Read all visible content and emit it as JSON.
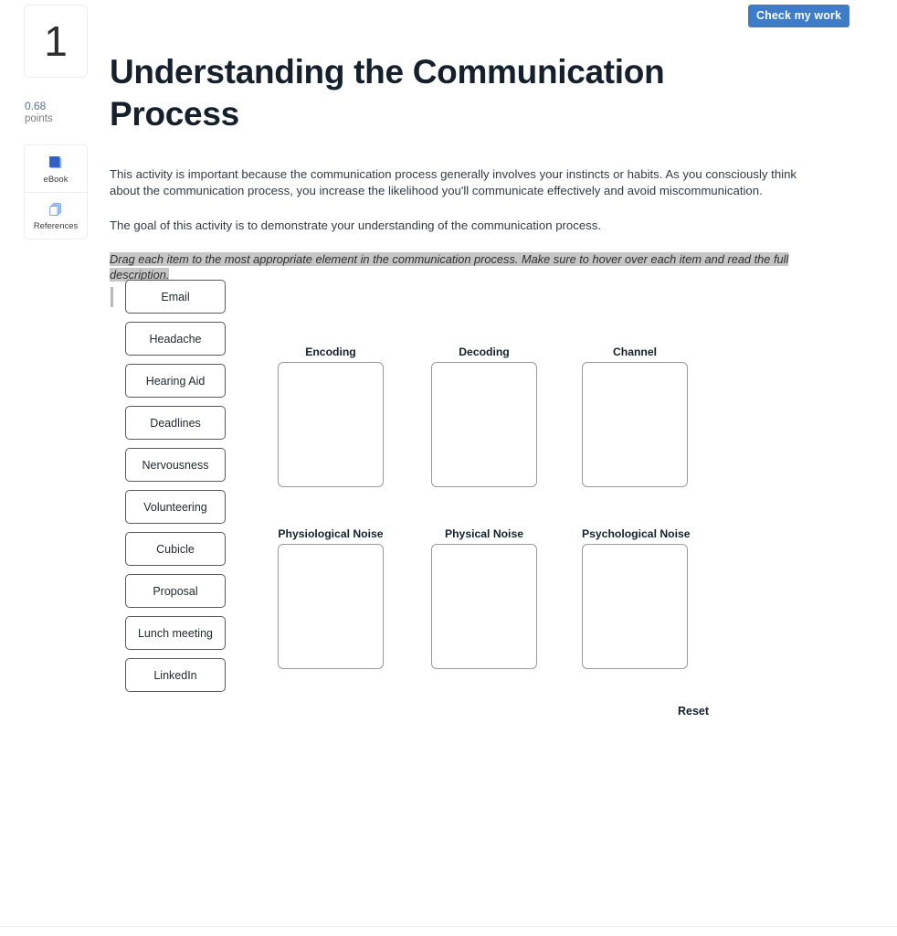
{
  "toolbar": {
    "check_work_label": "Check my work"
  },
  "sidebar": {
    "question_number": "1",
    "points_value": "0.68",
    "points_label": "points",
    "resources": [
      {
        "icon": "ebook-icon",
        "label": "eBook"
      },
      {
        "icon": "references-icon",
        "label": "References"
      }
    ]
  },
  "header": {
    "title": "Understanding the Communication Process"
  },
  "body": {
    "intro": "This activity is important because the communication process generally involves your instincts or habits. As you consciously think about the communication process, you increase the likelihood you'll communicate effectively and avoid miscommunication.",
    "goal": "The goal of this activity is to demonstrate your understanding of the communication process.",
    "instruction": "Drag each item to the most appropriate element in the communication process. Make sure to hover over each item and read the full description."
  },
  "activity": {
    "items": [
      {
        "label": "Email"
      },
      {
        "label": "Headache"
      },
      {
        "label": "Hearing Aid"
      },
      {
        "label": "Deadlines"
      },
      {
        "label": "Nervousness"
      },
      {
        "label": "Volunteering"
      },
      {
        "label": "Cubicle"
      },
      {
        "label": "Proposal"
      },
      {
        "label": "Lunch meeting"
      },
      {
        "label": "LinkedIn"
      }
    ],
    "dropzones_row1": [
      {
        "label": "Encoding",
        "contents": []
      },
      {
        "label": "Decoding",
        "contents": []
      },
      {
        "label": "Channel",
        "contents": []
      }
    ],
    "dropzones_row2": [
      {
        "label": "Physiological Noise",
        "contents": []
      },
      {
        "label": "Physical Noise",
        "contents": []
      },
      {
        "label": "Psychological Noise",
        "contents": []
      }
    ],
    "reset_label": "Reset"
  },
  "colors": {
    "accent_blue": "#3d7cc9",
    "heading": "#16202c",
    "points": "#5b7189",
    "highlight": "#c6c6c6",
    "item_border": "#58585a",
    "dropzone_border": "#9a9a9a"
  }
}
